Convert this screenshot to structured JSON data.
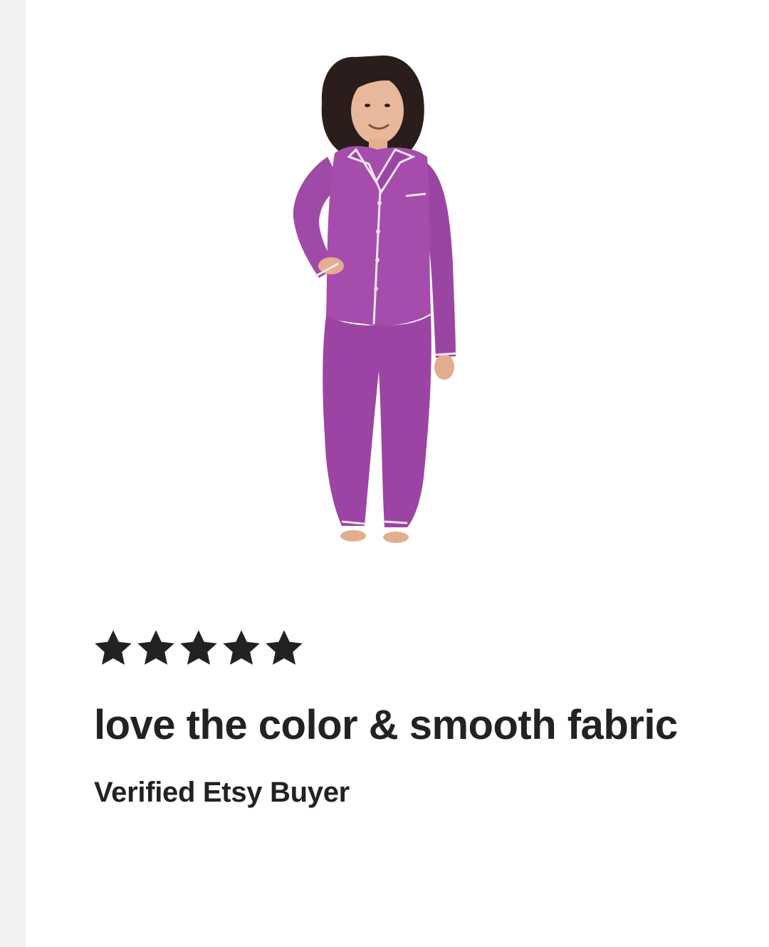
{
  "colors": {
    "text": "#222222",
    "star": "#222222",
    "gutter": "#f1f1f1",
    "pajama": "#a04aa8",
    "piping": "#f4e6f2"
  },
  "product_image": {
    "icon": "product-photo-pajamas"
  },
  "review": {
    "rating": 5,
    "rating_max": 5,
    "title": "love the color & smooth fabric",
    "reviewer": "Verified Etsy Buyer"
  }
}
